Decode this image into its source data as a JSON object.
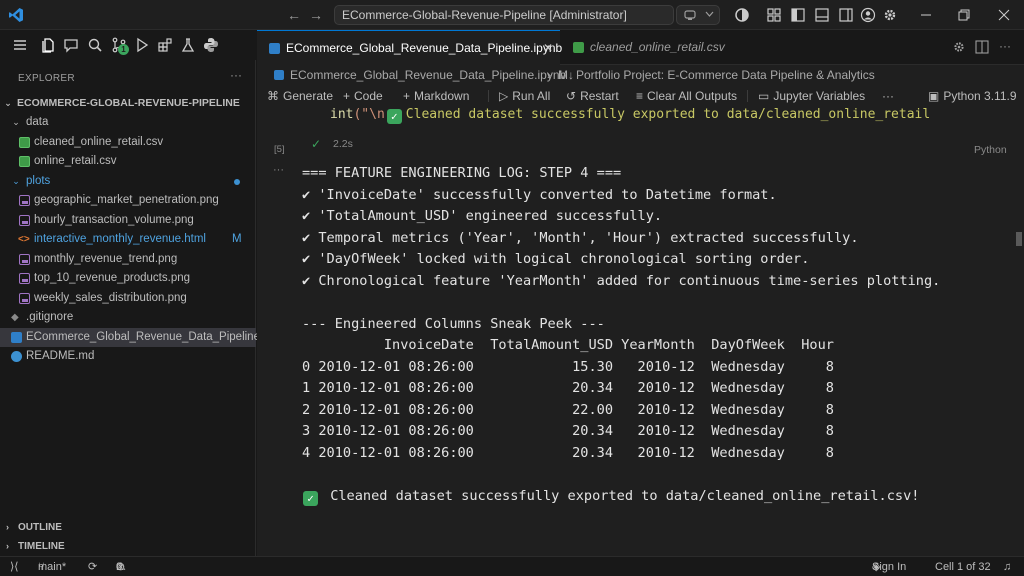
{
  "titlebar": {
    "search_text": "ECommerce-Global-Revenue-Pipeline [Administrator]",
    "back_glyph": "←",
    "forward_glyph": "→",
    "icons": [
      "vscode-logo-icon",
      "copilot-icon",
      "accounts-shield-icon",
      "layout-icon",
      "toggle-sidebar-icon",
      "toggle-panel-icon",
      "toggle-secondary-sidebar-icon",
      "account-icon",
      "settings-gear-icon",
      "minimize-icon",
      "restore-icon",
      "close-icon"
    ],
    "accent_color": "#0078d4"
  },
  "activity": {
    "icons": [
      "menu-icon",
      "explorer-icon",
      "chat-icon",
      "search-icon",
      "source-control-icon",
      "run-debug-icon",
      "extensions-icon",
      "testing-icon",
      "python-icon"
    ],
    "source_control_badge": "1"
  },
  "explorer": {
    "title": "EXPLORER",
    "more": "···",
    "root": "ECOMMERCE-GLOBAL-REVENUE-PIPELINE",
    "folders": {
      "data": "data",
      "plots": "plots"
    },
    "files": {
      "cleaned_csv": "cleaned_online_retail.csv",
      "online_csv": "online_retail.csv",
      "geo": "geographic_market_penetration.png",
      "hourly": "hourly_transaction_volume.png",
      "interactive": "interactive_monthly_revenue.html",
      "interactive_badge": "M",
      "monthly": "monthly_revenue_trend.png",
      "top10": "top_10_revenue_products.png",
      "weekly": "weekly_sales_distribution.png",
      "gitignore": ".gitignore",
      "notebook": "ECommerce_Global_Revenue_Data_Pipeline...",
      "readme": "README.md"
    },
    "outline": "OUTLINE",
    "timeline": "TIMELINE"
  },
  "tabs": {
    "active": "ECommerce_Global_Revenue_Data_Pipeline.ipynb",
    "close": "✕",
    "second": "cleaned_online_retail.csv"
  },
  "breadcrumbs": {
    "file": "ECommerce_Global_Revenue_Data_Pipeline.ipynb",
    "sep": "›",
    "markdown_prefix": "M↓",
    "section": "Portfolio Project: E-Commerce Data Pipeline & Analytics"
  },
  "toolbar": {
    "generate": "Generate",
    "code": "Code",
    "markdown": "Markdown",
    "run_all": "Run All",
    "restart": "Restart",
    "clear": "Clear All Outputs",
    "variables": "Jupyter Variables",
    "more": "···",
    "kernel": "Python 3.11.9"
  },
  "cell": {
    "code_fn": "int",
    "code_str": "(\"\\n",
    "code_tail": "Cleaned dataset successfully exported to data/cleaned_online_retail",
    "exec_count": "[5]",
    "duration": "2.2s",
    "language": "Python",
    "output_more": "···"
  },
  "output": {
    "lines": [
      "=== FEATURE ENGINEERING LOG: STEP 4 ===",
      "✔ 'InvoiceDate' successfully converted to Datetime format.",
      "✔ 'TotalAmount_USD' engineered successfully.",
      "✔ Temporal metrics ('Year', 'Month', 'Hour') extracted successfully.",
      "✔ 'DayOfWeek' locked with logical chronological sorting order.",
      "✔ Chronological feature 'YearMonth' added for continuous time-series plotting.",
      "",
      "--- Engineered Columns Sneak Peek ---",
      "          InvoiceDate  TotalAmount_USD YearMonth  DayOfWeek  Hour",
      "0 2010-12-01 08:26:00            15.30   2010-12  Wednesday     8",
      "1 2010-12-01 08:26:00            20.34   2010-12  Wednesday     8",
      "2 2010-12-01 08:26:00            22.00   2010-12  Wednesday     8",
      "3 2010-12-01 08:26:00            20.34   2010-12  Wednesday     8",
      "4 2010-12-01 08:26:00            20.34   2010-12  Wednesday     8"
    ],
    "final_check": "✓",
    "final_line": "Cleaned dataset successfully exported to data/cleaned_online_retail.csv!"
  },
  "statusbar": {
    "branch": "main*",
    "errors": "0",
    "warnings": "0",
    "sign_in": "Sign In",
    "cell_position": "Cell 1 of 32"
  }
}
